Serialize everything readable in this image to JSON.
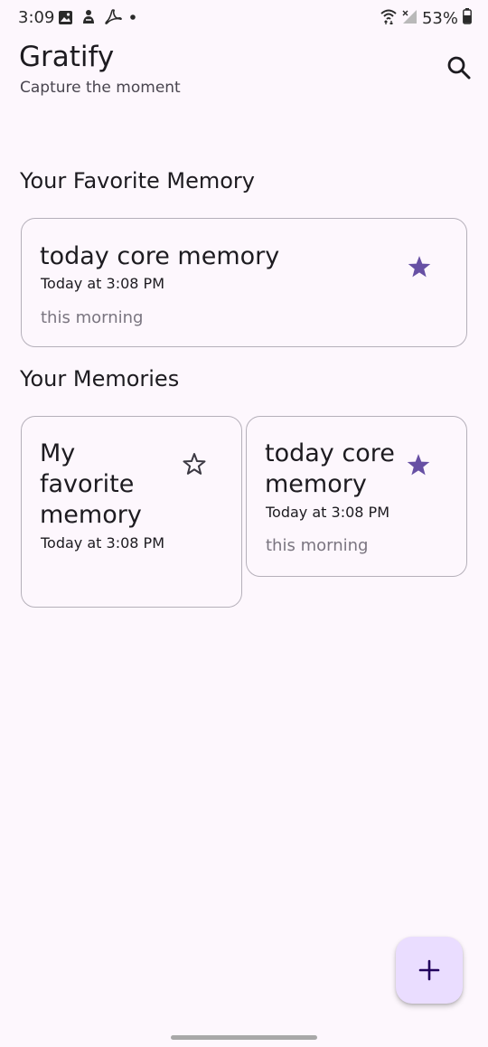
{
  "status_bar": {
    "time": "3:09",
    "battery": "53%",
    "icons": [
      "gallery-icon",
      "app-notification-icon",
      "acrobat-icon",
      "dot-icon",
      "wifi-icon",
      "signal-icon",
      "battery-icon"
    ]
  },
  "header": {
    "title": "Gratify",
    "subtitle": "Capture the moment",
    "search_icon": "search-icon"
  },
  "favorite_section": {
    "title": "Your Favorite Memory",
    "card": {
      "title": "today core memory",
      "time": "Today at 3:08 PM",
      "note": "this morning",
      "favorite": true
    }
  },
  "memories_section": {
    "title": "Your Memories",
    "cards": [
      {
        "title_lines": [
          "My",
          "favorite",
          "memory"
        ],
        "time": "Today at 3:08 PM",
        "note": "",
        "favorite": false
      },
      {
        "title_lines": [
          "today core",
          "memory"
        ],
        "time": "Today at 3:08 PM",
        "note": "this morning",
        "favorite": true
      }
    ]
  },
  "fab": {
    "icon": "plus-icon"
  },
  "colors": {
    "background": "#fdf7fd",
    "accent": "#6750a4",
    "card_border": "#b5b0ba",
    "fab_bg": "#eaddff"
  }
}
